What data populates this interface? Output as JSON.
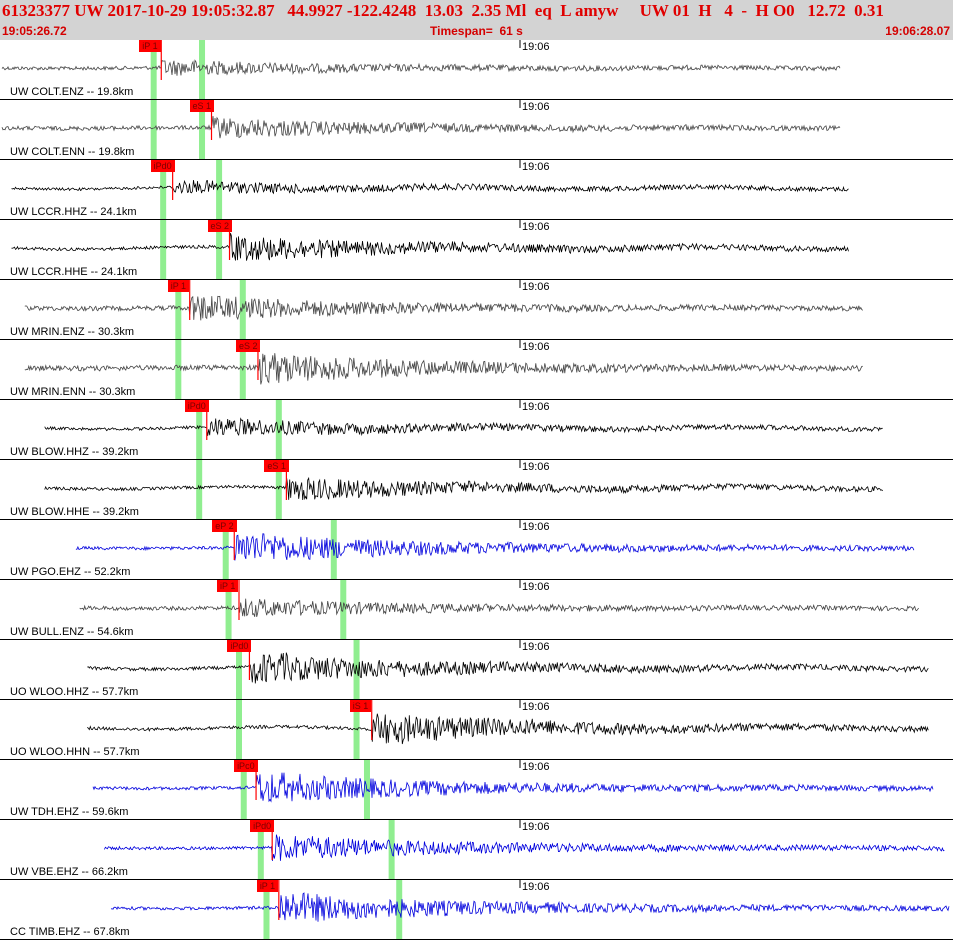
{
  "header": {
    "title": "61323377 UW 2017-10-29 19:05:32.87   44.9927 -122.4248  13.03  2.35 Ml  eq  L amyw     UW 01  H   4  -  H O0   12.72  0.31",
    "start_time": "19:05:26.72",
    "timespan": "Timespan=  61 s",
    "end_time": "19:06:28.07"
  },
  "colors": {
    "header_bg": "#d3d3d3",
    "header_text": "#e00000",
    "pick_red": "#ff0000",
    "window_green": "#90ee90",
    "trace_gray": "#444444",
    "trace_black": "#000000",
    "trace_blue": "#0000dd"
  },
  "traces": [
    {
      "label": "UW COLT.ENZ -- 19.8km",
      "tick": "19:06",
      "pick": "iP 1",
      "color": "gray",
      "start": 0.0,
      "end": 0.885,
      "arrival": 0.168,
      "amp": 0.25,
      "green": [
        0.16,
        0.211
      ]
    },
    {
      "label": "UW COLT.ENN -- 19.8km",
      "tick": "19:06",
      "pick": "eS 1",
      "color": "gray",
      "start": 0.0,
      "end": 0.885,
      "arrival": 0.221,
      "amp": 0.35,
      "green": [
        0.16,
        0.211
      ]
    },
    {
      "label": "UW LCCR.HHZ -- 24.1km",
      "tick": "19:06",
      "pick": "iPd0",
      "color": "black",
      "start": 0.01,
      "end": 0.893,
      "arrival": 0.18,
      "amp": 0.2,
      "green": [
        0.17,
        0.229
      ]
    },
    {
      "label": "UW LCCR.HHE -- 24.1km",
      "tick": "19:06",
      "pick": "eS 2",
      "color": "black",
      "start": 0.01,
      "end": 0.893,
      "arrival": 0.24,
      "amp": 0.45,
      "green": [
        0.17,
        0.229
      ]
    },
    {
      "label": "UW MRIN.ENZ -- 30.3km",
      "tick": "19:06",
      "pick": "iP 1",
      "color": "gray",
      "start": 0.024,
      "end": 0.908,
      "arrival": 0.198,
      "amp": 0.45,
      "green": [
        0.186,
        0.254
      ]
    },
    {
      "label": "UW MRIN.ENN -- 30.3km",
      "tick": "19:06",
      "pick": "eS 2",
      "color": "gray",
      "start": 0.024,
      "end": 0.908,
      "arrival": 0.27,
      "amp": 0.55,
      "green": [
        0.186,
        0.254
      ]
    },
    {
      "label": "UW BLOW.HHZ -- 39.2km",
      "tick": "19:06",
      "pick": "iPd0",
      "color": "black",
      "start": 0.045,
      "end": 0.93,
      "arrival": 0.216,
      "amp": 0.3,
      "green": [
        0.208,
        0.292
      ]
    },
    {
      "label": "UW BLOW.HHE -- 39.2km",
      "tick": "19:06",
      "pick": "eS 1",
      "color": "black",
      "start": 0.045,
      "end": 0.93,
      "arrival": 0.3,
      "amp": 0.4,
      "green": [
        0.208,
        0.292
      ]
    },
    {
      "label": "UW PGO.EHZ -- 52.2km",
      "tick": "19:06",
      "pick": "eP 2",
      "color": "blue",
      "start": 0.078,
      "end": 0.962,
      "arrival": 0.245,
      "amp": 0.55,
      "green": [
        0.236,
        0.35
      ]
    },
    {
      "label": "UW BULL.ENZ -- 54.6km",
      "tick": "19:06",
      "pick": "iP 1",
      "color": "gray",
      "start": 0.082,
      "end": 0.968,
      "arrival": 0.25,
      "amp": 0.3,
      "green": [
        0.239,
        0.36
      ]
    },
    {
      "label": "UO WLOO.HHZ -- 57.7km",
      "tick": "19:06",
      "pick": "iPd0",
      "color": "black",
      "start": 0.09,
      "end": 0.978,
      "arrival": 0.261,
      "amp": 0.55,
      "green": [
        0.25,
        0.374
      ]
    },
    {
      "label": "UO WLOO.HHN -- 57.7km",
      "tick": "19:06",
      "pick": "iS 1",
      "color": "black",
      "start": 0.09,
      "end": 0.978,
      "arrival": 0.39,
      "amp": 0.55,
      "green": [
        0.25,
        0.374
      ]
    },
    {
      "label": "UW TDH.EHZ -- 59.6km",
      "tick": "19:06",
      "pick": "iPc0",
      "color": "blue",
      "start": 0.096,
      "end": 0.983,
      "arrival": 0.268,
      "amp": 0.55,
      "green": [
        0.255,
        0.385
      ]
    },
    {
      "label": "UW VBE.EHZ -- 66.2km",
      "tick": "19:06",
      "pick": "iPd0",
      "color": "blue",
      "start": 0.108,
      "end": 0.995,
      "arrival": 0.285,
      "amp": 0.45,
      "green": [
        0.273,
        0.411
      ]
    },
    {
      "label": "CC TIMB.EHZ -- 67.8km",
      "tick": "19:06",
      "pick": "iP 1",
      "color": "blue",
      "start": 0.115,
      "end": 1.0,
      "arrival": 0.292,
      "amp": 0.55,
      "green": [
        0.279,
        0.419
      ]
    }
  ]
}
